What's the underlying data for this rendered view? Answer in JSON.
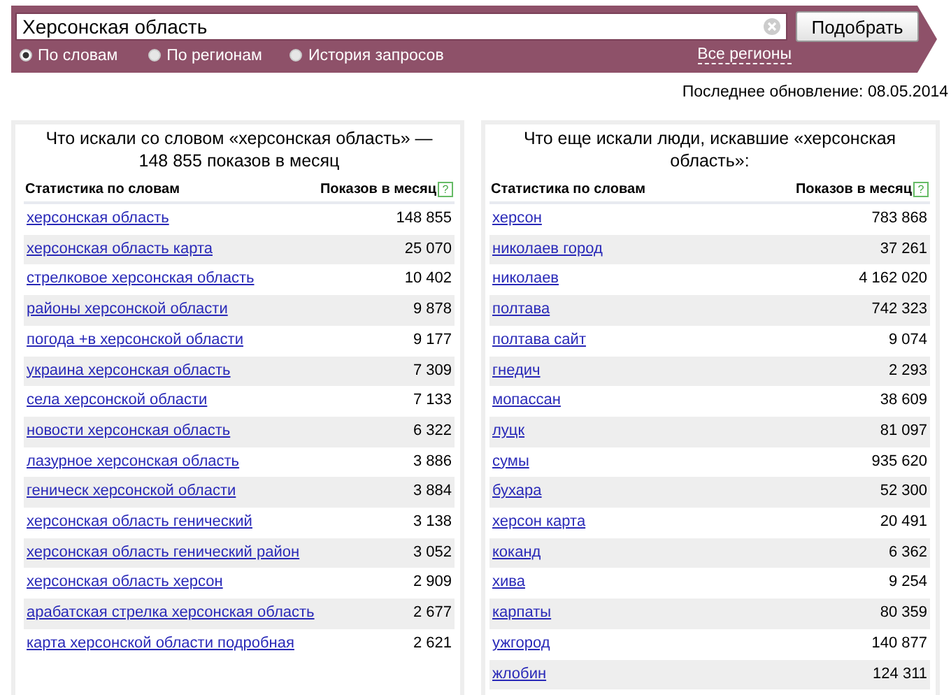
{
  "search": {
    "value": "Херсонская область",
    "button": "Подобрать"
  },
  "modes": [
    {
      "label": "По словам",
      "selected": true
    },
    {
      "label": "По регионам",
      "selected": false
    },
    {
      "label": "История запросов",
      "selected": false
    }
  ],
  "regions_link": "Все регионы",
  "last_update": "Последнее обновление: 08.05.2014",
  "panels": [
    {
      "title": "Что искали со словом «херсонская область» — 148 855 показов в месяц",
      "columns": [
        "Статистика по словам",
        "Показов в месяц"
      ],
      "help": "?",
      "rows": [
        {
          "query": "херсонская область",
          "count": "148 855"
        },
        {
          "query": "херсонская область карта",
          "count": "25 070"
        },
        {
          "query": "стрелковое херсонская область",
          "count": "10 402"
        },
        {
          "query": "районы херсонской области",
          "count": "9 878"
        },
        {
          "query": "погода +в херсонской области",
          "count": "9 177"
        },
        {
          "query": "украина херсонская область",
          "count": "7 309"
        },
        {
          "query": "села херсонской области",
          "count": "7 133"
        },
        {
          "query": "новости херсонская область",
          "count": "6 322"
        },
        {
          "query": "лазурное херсонская область",
          "count": "3 886"
        },
        {
          "query": "геническ херсонской области",
          "count": "3 884"
        },
        {
          "query": "херсонская область генический",
          "count": "3 138"
        },
        {
          "query": "херсонская область генический район",
          "count": "3 052"
        },
        {
          "query": "херсонская область херсон",
          "count": "2 909"
        },
        {
          "query": "арабатская стрелка херсонская область",
          "count": "2 677"
        },
        {
          "query": "карта херсонской области подробная",
          "count": "2 621"
        }
      ]
    },
    {
      "title": "Что еще искали люди, искавшие «херсонская область»:",
      "columns": [
        "Статистика по словам",
        "Показов в месяц"
      ],
      "help": "?",
      "rows": [
        {
          "query": "херсон",
          "count": "783 868"
        },
        {
          "query": "николаев город",
          "count": "37 261"
        },
        {
          "query": "николаев",
          "count": "4 162 020"
        },
        {
          "query": "полтава",
          "count": "742 323"
        },
        {
          "query": "полтава сайт",
          "count": "9 074"
        },
        {
          "query": "гнедич",
          "count": "2 293"
        },
        {
          "query": "мопассан",
          "count": "38 609"
        },
        {
          "query": "луцк",
          "count": "81 097"
        },
        {
          "query": "сумы",
          "count": "935 620"
        },
        {
          "query": "бухара",
          "count": "52 300"
        },
        {
          "query": "херсон карта",
          "count": "20 491"
        },
        {
          "query": "коканд",
          "count": "6 362"
        },
        {
          "query": "хива",
          "count": "9 254"
        },
        {
          "query": "карпаты",
          "count": "80 359"
        },
        {
          "query": "ужгород",
          "count": "140 877"
        },
        {
          "query": "жлобин",
          "count": "124 311"
        }
      ]
    }
  ]
}
